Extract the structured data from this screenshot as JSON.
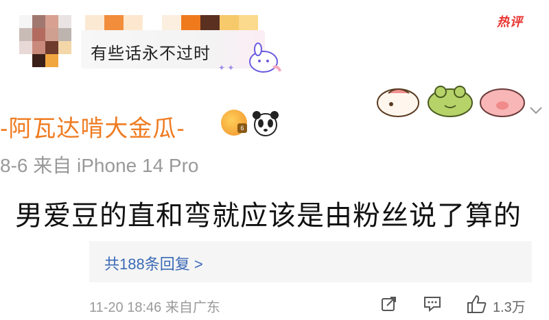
{
  "header": {
    "hot_tag": "热评",
    "quote_text": "有些话永不过时"
  },
  "post": {
    "author": "-阿瓦达啃大金瓜-",
    "meta": "8-6 来自 iPhone 14 Pro",
    "content": "男爱豆的直和弯就应该是由粉丝说了算的"
  },
  "comment": {
    "replies_link": "共188条回复 >",
    "meta": "11-20 18:46 来自广东",
    "like_count": "1.3万"
  },
  "colors": {
    "accent_orange": "#ef7b21",
    "link_blue": "#3b69b5",
    "hot_red": "#e8322f"
  },
  "icons": [
    "share-icon",
    "comment-icon",
    "like-icon",
    "chevron-down-icon",
    "panda-icon",
    "crown-icon"
  ]
}
